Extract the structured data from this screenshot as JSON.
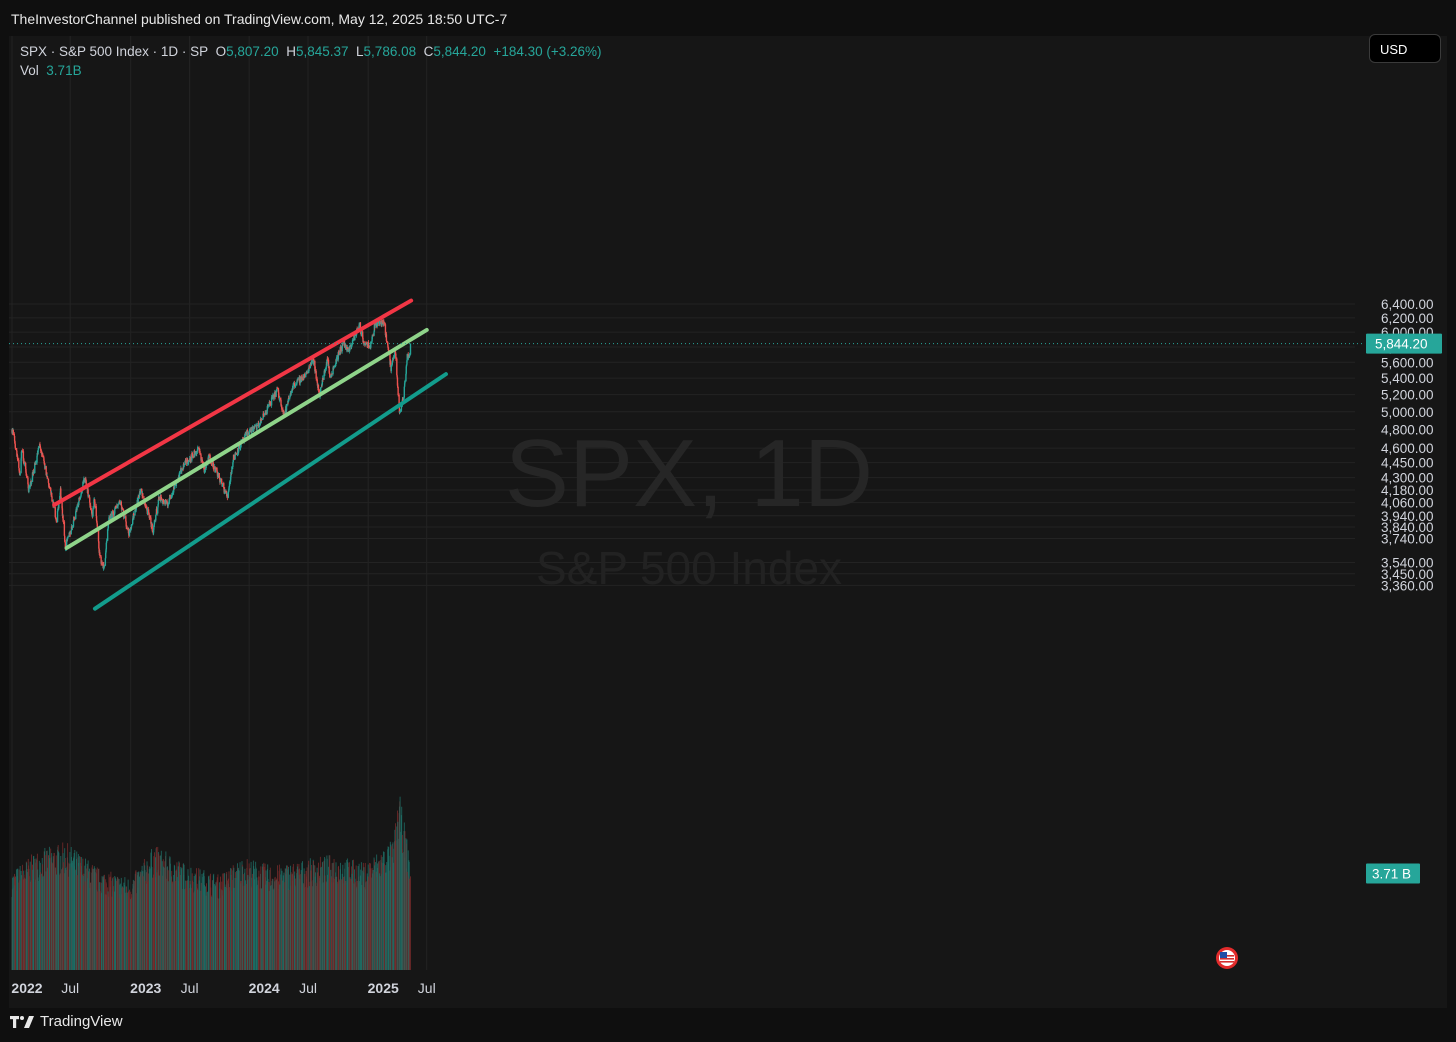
{
  "publisher_line": "TheInvestorChannel published on TradingView.com, May 12, 2025 18:50 UTC-7",
  "legend": {
    "symbol": "SPX · S&P 500 Index · 1D · SP",
    "open_label": "O",
    "open": "5,807.20",
    "high_label": "H",
    "high": "5,845.37",
    "low_label": "L",
    "low": "5,786.08",
    "close_label": "C",
    "close": "5,844.20",
    "change": "+184.30 (+3.26%)",
    "vol_label": "Vol",
    "vol": "3.71B"
  },
  "currency_button": "USD",
  "watermark": {
    "symbol": "SPX, 1D",
    "name": "S&P 500 Index"
  },
  "brand": "TradingView",
  "colors": {
    "up": "#26a69a",
    "down": "#ef5350",
    "upper_channel": "#f23645",
    "middle_channel": "#8fd48a",
    "lower_channel": "#129c8c"
  },
  "chart_data": {
    "type": "candlestick",
    "symbol": "SPX",
    "interval": "1D",
    "price_axis": {
      "scale": "log",
      "ticks": [
        "3,360.00",
        "3,450.00",
        "3,540.00",
        "3,740.00",
        "3,840.00",
        "3,940.00",
        "4,060.00",
        "4,180.00",
        "4,300.00",
        "4,450.00",
        "4,600.00",
        "4,800.00",
        "5,000.00",
        "5,200.00",
        "5,400.00",
        "5,600.00",
        "5,800.00",
        "6,000.00",
        "6,200.00",
        "6,400.00"
      ]
    },
    "time_axis": {
      "ticks": [
        {
          "label": "2022",
          "date": "2022-01-03",
          "bold": true
        },
        {
          "label": "Jul",
          "date": "2022-07-01",
          "bold": false
        },
        {
          "label": "2023",
          "date": "2023-01-03",
          "bold": true
        },
        {
          "label": "Jul",
          "date": "2023-07-03",
          "bold": false
        },
        {
          "label": "2024",
          "date": "2024-01-02",
          "bold": true
        },
        {
          "label": "Jul",
          "date": "2024-07-01",
          "bold": false
        },
        {
          "label": "2025",
          "date": "2025-01-02",
          "bold": true
        },
        {
          "label": "Jul",
          "date": "2025-07-01",
          "bold": false
        }
      ]
    },
    "last_price_label": "5,844.20",
    "last_price": 5844.2,
    "volume_label": "3.71 B",
    "volume_last": 3.71,
    "volume_unit": "B",
    "price_path": [
      [
        "2022-01-03",
        4766
      ],
      [
        "2022-01-05",
        4810
      ],
      [
        "2022-01-27",
        4326
      ],
      [
        "2022-02-02",
        4590
      ],
      [
        "2022-02-24",
        4170
      ],
      [
        "2022-03-29",
        4630
      ],
      [
        "2022-05-02",
        4150
      ],
      [
        "2022-05-20",
        3900
      ],
      [
        "2022-06-01",
        4170
      ],
      [
        "2022-06-16",
        3667
      ],
      [
        "2022-07-05",
        3830
      ],
      [
        "2022-08-16",
        4305
      ],
      [
        "2022-09-07",
        3920
      ],
      [
        "2022-09-13",
        4110
      ],
      [
        "2022-09-30",
        3585
      ],
      [
        "2022-10-13",
        3490
      ],
      [
        "2022-10-28",
        3900
      ],
      [
        "2022-11-10",
        3960
      ],
      [
        "2022-12-01",
        4080
      ],
      [
        "2022-12-28",
        3780
      ],
      [
        "2023-01-10",
        3920
      ],
      [
        "2023-02-02",
        4180
      ],
      [
        "2023-03-13",
        3808
      ],
      [
        "2023-03-31",
        4110
      ],
      [
        "2023-04-25",
        4040
      ],
      [
        "2023-06-15",
        4430
      ],
      [
        "2023-07-31",
        4590
      ],
      [
        "2023-08-18",
        4370
      ],
      [
        "2023-09-01",
        4515
      ],
      [
        "2023-10-27",
        4115
      ],
      [
        "2023-11-15",
        4500
      ],
      [
        "2023-12-29",
        4770
      ],
      [
        "2024-01-31",
        4845
      ],
      [
        "2024-03-28",
        5255
      ],
      [
        "2024-04-19",
        4967
      ],
      [
        "2024-05-15",
        5300
      ],
      [
        "2024-06-28",
        5460
      ],
      [
        "2024-07-16",
        5667
      ],
      [
        "2024-08-05",
        5186
      ],
      [
        "2024-08-30",
        5650
      ],
      [
        "2024-09-06",
        5408
      ],
      [
        "2024-10-18",
        5865
      ],
      [
        "2024-11-01",
        5728
      ],
      [
        "2024-12-06",
        6090
      ],
      [
        "2024-12-18",
        5872
      ],
      [
        "2025-01-10",
        5827
      ],
      [
        "2025-01-23",
        6118
      ],
      [
        "2025-02-19",
        6144
      ],
      [
        "2025-03-13",
        5521
      ],
      [
        "2025-03-25",
        5777
      ],
      [
        "2025-04-08",
        4982
      ],
      [
        "2025-04-21",
        5158
      ],
      [
        "2025-05-02",
        5686
      ],
      [
        "2025-05-09",
        5660
      ],
      [
        "2025-05-12",
        5844
      ]
    ],
    "channel_lines": [
      {
        "name": "upper",
        "color": "#f23645",
        "from": [
          "2022-05-13",
          4040
        ],
        "to": [
          "2025-05-14",
          6450
        ]
      },
      {
        "name": "middle",
        "color": "#8fd48a",
        "from": [
          "2022-06-20",
          3660
        ],
        "to": [
          "2025-07-01",
          6030
        ]
      },
      {
        "name": "lower",
        "color": "#129c8c",
        "from": [
          "2022-09-15",
          3185
        ],
        "to": [
          "2025-08-29",
          5450
        ]
      }
    ],
    "volume_billions": [
      [
        "2022-01-03",
        3.3
      ],
      [
        "2022-03-18",
        4.0
      ],
      [
        "2022-06-17",
        4.3
      ],
      [
        "2022-09-30",
        3.4
      ],
      [
        "2023-01-03",
        3.1
      ],
      [
        "2023-03-17",
        4.2
      ],
      [
        "2023-06-16",
        3.6
      ],
      [
        "2023-10-02",
        3.2
      ],
      [
        "2023-12-15",
        3.8
      ],
      [
        "2024-03-15",
        3.5
      ],
      [
        "2024-06-21",
        3.7
      ],
      [
        "2024-09-20",
        3.9
      ],
      [
        "2024-12-20",
        3.6
      ],
      [
        "2025-03-21",
        4.4
      ],
      [
        "2025-04-07",
        6.0
      ],
      [
        "2025-05-12",
        3.71
      ]
    ]
  }
}
